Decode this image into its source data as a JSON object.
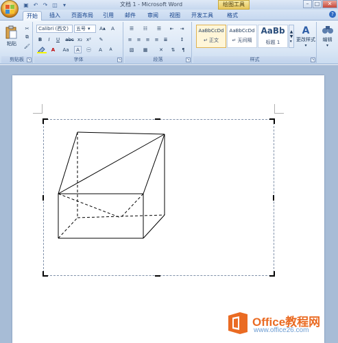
{
  "window": {
    "title": "文档 1 - Microsoft Word",
    "context_tab": "绘图工具"
  },
  "tabs": [
    {
      "label": "开始",
      "active": true
    },
    {
      "label": "插入"
    },
    {
      "label": "页面布局"
    },
    {
      "label": "引用"
    },
    {
      "label": "邮件"
    },
    {
      "label": "审阅"
    },
    {
      "label": "视图"
    },
    {
      "label": "开发工具"
    },
    {
      "label": "格式"
    }
  ],
  "ribbon": {
    "clipboard": {
      "label": "剪贴板",
      "paste": "粘贴"
    },
    "font": {
      "label": "字体",
      "font_name": "Calibri (西文)",
      "font_size": "五号",
      "bold": "B",
      "italic": "I",
      "underline": "U",
      "strike": "abc",
      "sub": "x₂",
      "sup": "x²",
      "color_a": "A",
      "aa": "Aa",
      "grow": "A",
      "shrink": "A"
    },
    "paragraph": {
      "label": "段落"
    },
    "styles": {
      "label": "样式",
      "items": [
        {
          "sample": "AaBbCcDd",
          "name": "正文",
          "selected": true
        },
        {
          "sample": "AaBbCcDd",
          "name": "无间隔"
        },
        {
          "sample": "AaBb",
          "name": "标题 1"
        }
      ],
      "change_styles": "更改样式"
    },
    "editing": {
      "label": "编辑"
    }
  },
  "watermark": {
    "name": "Office教程网",
    "url": "www.office26.com"
  },
  "colors": {
    "ribbon": "#dbe7f5",
    "accent_orange": "#ea6b23",
    "watermark_url": "#6b9bd1"
  }
}
